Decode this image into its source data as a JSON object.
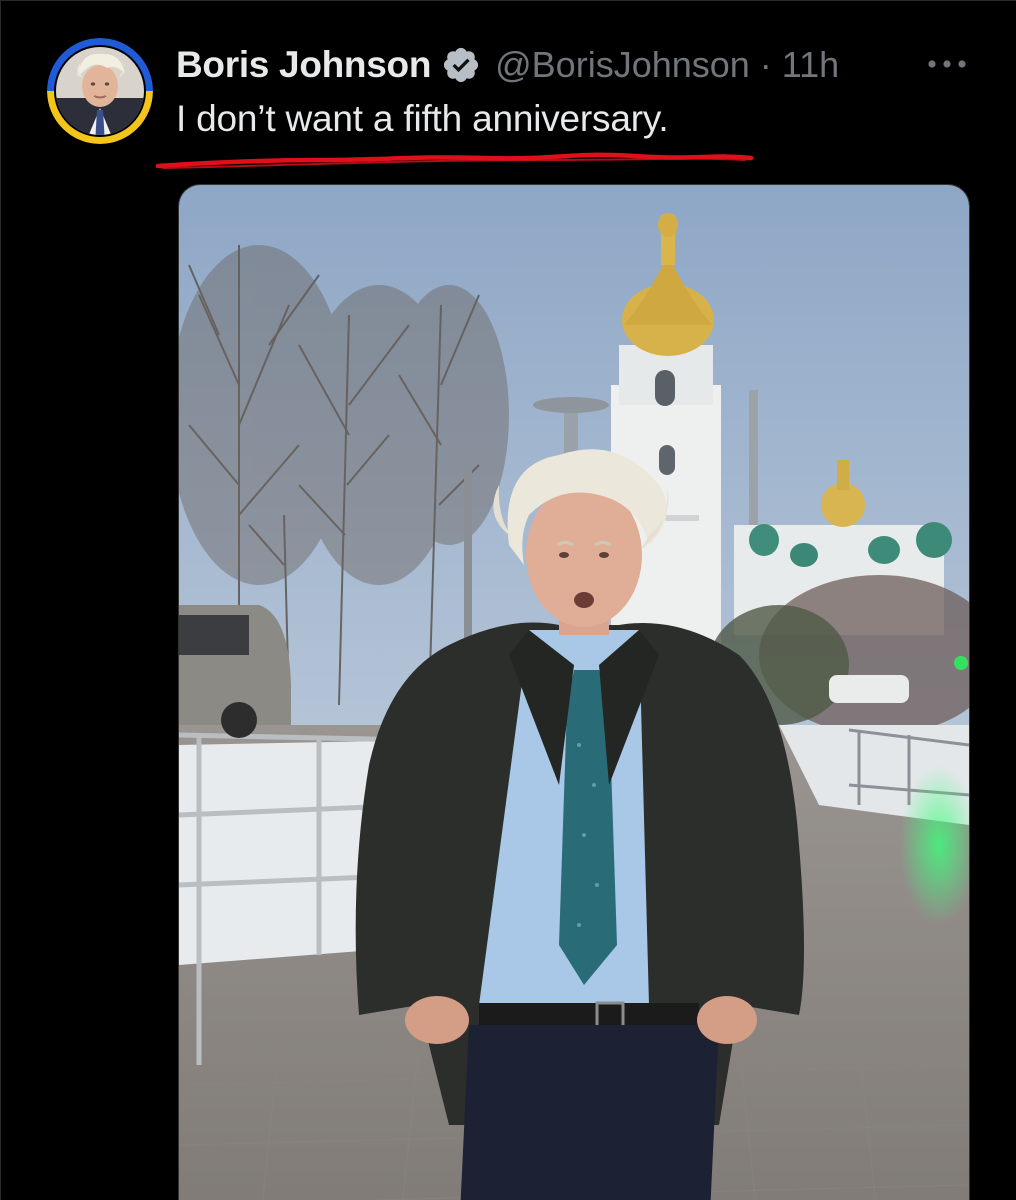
{
  "tweet": {
    "author": {
      "display_name": "Boris Johnson",
      "handle": "@BorisJohnson",
      "verified": true,
      "avatar": "profile-photo"
    },
    "separator": "·",
    "timestamp": "11h",
    "text": "I don’t want a fifth anniversary.",
    "media": "video-still-man-in-suit-in-front-of-cathedral"
  },
  "icons": {
    "verified": "verified-badge-icon",
    "more": "more-options-icon"
  },
  "colors": {
    "background": "#000000",
    "text_primary": "#e7e9ea",
    "text_secondary": "#71767b",
    "annotation_underline": "#e0101a",
    "avatar_ring_top": "#1f5bd6",
    "avatar_ring_bottom": "#f3c41a"
  }
}
